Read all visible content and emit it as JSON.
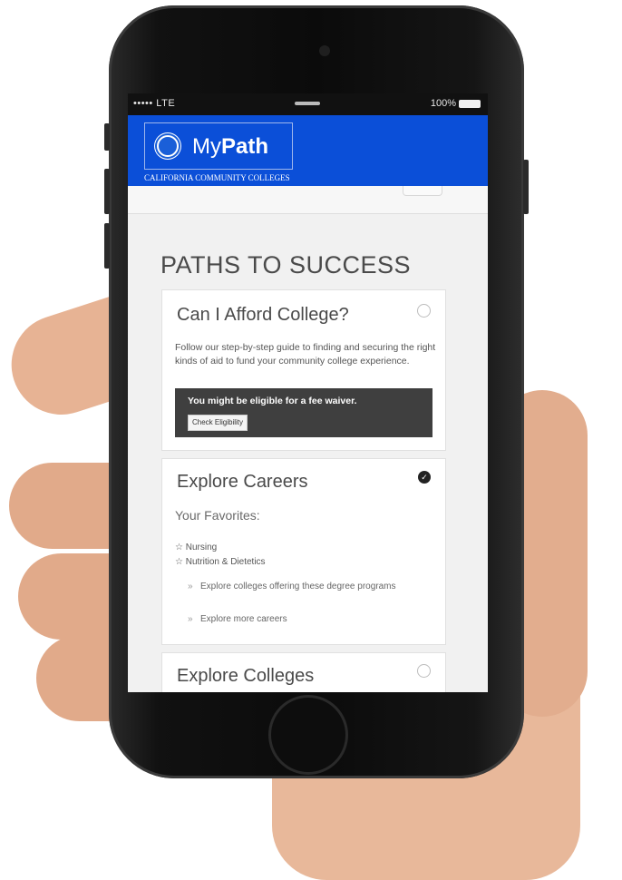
{
  "status_bar": {
    "carrier": "••••• LTE",
    "battery": "100%"
  },
  "header": {
    "logo_prefix": "My",
    "logo_bold": "Path",
    "subtitle": "CALIFORNIA COMMUNITY COLLEGES"
  },
  "page": {
    "title": "PATHS TO SUCCESS"
  },
  "cards": {
    "afford": {
      "title": "Can I Afford College?",
      "description": "Follow our step-by-step guide to finding and securing the right kinds of aid to fund your community college experience.",
      "waiver_text": "You might be eligible for a fee waiver.",
      "waiver_button": "Check Eligibility"
    },
    "careers": {
      "title": "Explore Careers",
      "favorites_heading": "Your Favorites:",
      "favorites": [
        "Nursing",
        "Nutrition & Dietetics"
      ],
      "links": [
        "Explore colleges offering these degree programs",
        "Explore more careers"
      ]
    },
    "colleges": {
      "title": "Explore Colleges"
    }
  },
  "icons": {
    "star": "☆",
    "arrow": "»",
    "check": "✓"
  },
  "colors": {
    "brand_blue": "#0b4fd8",
    "waiver_bg": "#3f3f3f"
  }
}
